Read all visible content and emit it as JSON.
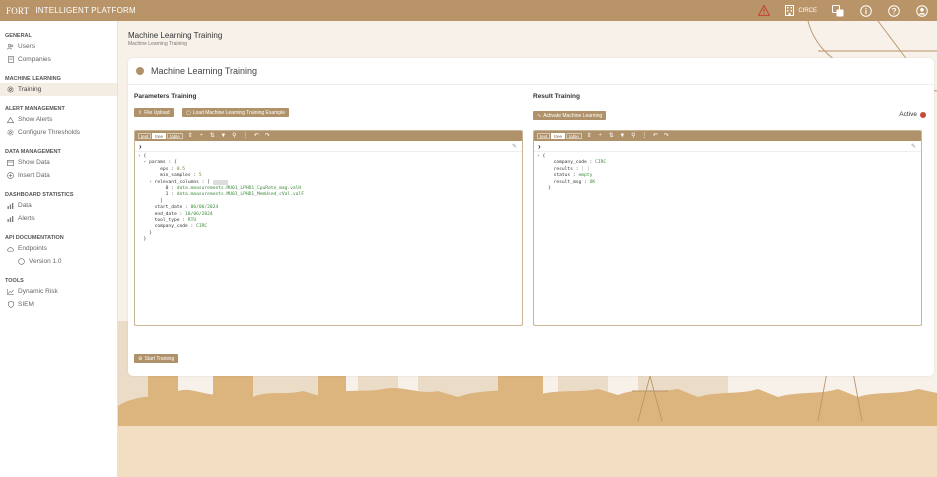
{
  "app": {
    "brand": "FORT",
    "title": "INTELLIGENT PLATFORM",
    "org": "CIRCE"
  },
  "sidebar": {
    "sections": [
      {
        "title": "GENERAL",
        "items": [
          {
            "label": "Users",
            "icon": "users-icon"
          },
          {
            "label": "Companies",
            "icon": "building-icon"
          }
        ]
      },
      {
        "title": "MACHINE LEARNING",
        "items": [
          {
            "label": "Training",
            "icon": "gear-icon",
            "active": true
          }
        ]
      },
      {
        "title": "ALERT MANAGEMENT",
        "items": [
          {
            "label": "Show Alerts",
            "icon": "warning-icon"
          },
          {
            "label": "Configure Thresholds",
            "icon": "gear-icon"
          }
        ]
      },
      {
        "title": "DATA MANAGEMENT",
        "items": [
          {
            "label": "Show Data",
            "icon": "table-icon"
          },
          {
            "label": "Insert Data",
            "icon": "plus-circle-icon"
          }
        ]
      },
      {
        "title": "DASHBOARD STATISTICS",
        "items": [
          {
            "label": "Data",
            "icon": "bar-chart-icon"
          },
          {
            "label": "Alerts",
            "icon": "bar-chart-icon"
          }
        ]
      },
      {
        "title": "API DOCUMENTATION",
        "items": [
          {
            "label": "Endpoints",
            "icon": "cloud-icon"
          },
          {
            "label": "Version 1.0",
            "icon": "circle-icon",
            "sub": true
          }
        ]
      },
      {
        "title": "TOOLS",
        "items": [
          {
            "label": "Dynamic Risk",
            "icon": "line-chart-icon"
          },
          {
            "label": "SIEM",
            "icon": "shield-icon"
          }
        ]
      }
    ]
  },
  "page": {
    "title": "Machine Learning Training",
    "breadcrumb": "Machine Learning Training",
    "card_title": "Machine Learning Training"
  },
  "params": {
    "title": "Parameters Training",
    "upload_label": "File Upload",
    "load_example_label": "Load Machine Learning Training Example"
  },
  "result": {
    "title": "Result Training",
    "activate_label": "Activate Machine Learning",
    "status_label": "Active",
    "status_color": "#c44a3a"
  },
  "editor": {
    "modes": [
      "text",
      "tree",
      "table"
    ],
    "selected_mode": "tree"
  },
  "params_json": {
    "eps": "0.5",
    "min_samples": "5",
    "col0": "data.measurements.MU01_LPHD1_CpuRate_mag.valH",
    "col1": "data.measurements.MU01_LPHD1_MemUsed_cVal.valF",
    "start_date": "06/06/2024",
    "end_date": "10/06/2024",
    "tool_type": "RTU",
    "company_code": "CIRC"
  },
  "result_json": {
    "company_code": "CIRC",
    "status": "empty",
    "result_msg": "OK"
  },
  "start_label": "Start Training",
  "colors": {
    "accent": "#b0926a",
    "topbar": "#b89468"
  }
}
